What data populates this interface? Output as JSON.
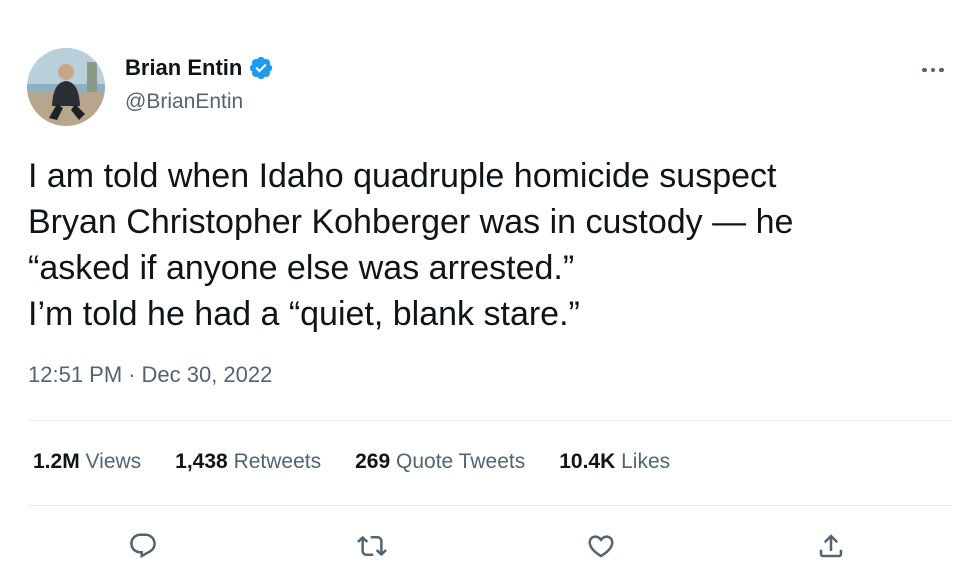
{
  "author": {
    "display_name": "Brian Entin",
    "handle": "@BrianEntin",
    "verified": true,
    "avatar_icon": "avatar-photo"
  },
  "tweet": {
    "lines": [
      "I am told when Idaho quadruple homicide suspect",
      "Bryan Christopher Kohberger was in custody — he",
      "“asked if anyone else was arrested.”",
      "I’m told he had a “quiet, blank stare.”"
    ]
  },
  "meta": {
    "time": "12:51 PM",
    "separator": "·",
    "date": "Dec 30, 2022"
  },
  "stats": {
    "views_count": "1.2M",
    "views_label": "Views",
    "retweets_count": "1,438",
    "retweets_label": "Retweets",
    "quotes_count": "269",
    "quotes_label": "Quote Tweets",
    "likes_count": "10.4K",
    "likes_label": "Likes"
  },
  "actions": [
    {
      "name": "reply",
      "icon": "reply-icon"
    },
    {
      "name": "retweet",
      "icon": "retweet-icon"
    },
    {
      "name": "like",
      "icon": "heart-icon"
    },
    {
      "name": "share",
      "icon": "share-icon"
    }
  ],
  "colors": {
    "text_primary": "#0f1419",
    "text_secondary": "#536471",
    "verified_blue": "#1d9bf0",
    "divider": "#e6ecf0"
  }
}
